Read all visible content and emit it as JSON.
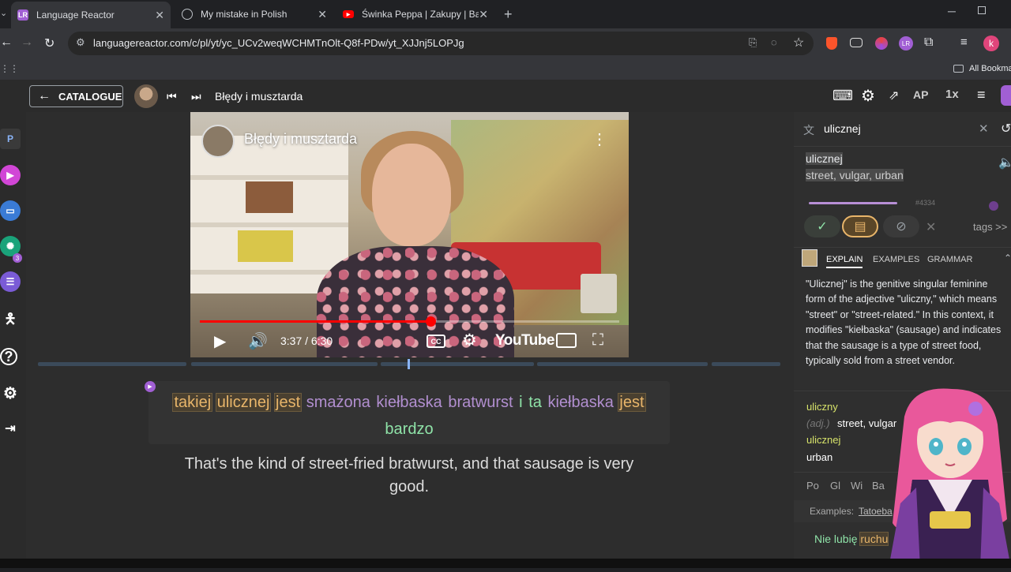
{
  "browser": {
    "tabs": [
      {
        "title": "Language Reactor",
        "favicon": "LR",
        "color": "#a15fd4"
      },
      {
        "title": "My mistake in Polish",
        "favicon": "globe",
        "color": "#9aa0a6"
      },
      {
        "title": "Świnka Peppa | Zakupy | Bajki P",
        "favicon": "youtube",
        "color": "#ff0000"
      }
    ],
    "url": "languagereactor.com/c/pl/yt/yc_UCv2weqWCHMTnOlt-Q8f-PDw/yt_XJJnj5LOPJg",
    "bookmarks_label": "All Bookmar",
    "profile_letter": "k"
  },
  "appbar": {
    "catalogue_label": "CATALOGUE",
    "video_title": "Błędy i musztarda",
    "speed": "1x",
    "ap_label": "AP"
  },
  "rail": {
    "p_label": "P",
    "badge_count": "3"
  },
  "video": {
    "title": "Błędy i musztarda",
    "time": "3:37 / 6:30",
    "progress": 0.55,
    "youtube_label": "YouTube"
  },
  "subtitle": {
    "words": [
      {
        "text": "takiej",
        "style": "hl"
      },
      {
        "text": "ulicznej",
        "style": "hl"
      },
      {
        "text": "jest",
        "style": "hl"
      },
      {
        "text": "smażona",
        "style": "purple"
      },
      {
        "text": "kiełbaska",
        "style": "purple"
      },
      {
        "text": "bratwurst",
        "style": "purple"
      },
      {
        "text": "i",
        "style": "green"
      },
      {
        "text": "ta",
        "style": "green"
      },
      {
        "text": "kiełbaska",
        "style": "purple"
      },
      {
        "text": "jest",
        "style": "hl"
      },
      {
        "text": "bardzo",
        "style": "green"
      }
    ],
    "translation": "That's the kind of street-fried bratwurst, and that sausage is very good."
  },
  "panel": {
    "search_value": "ulicznej",
    "word": "ulicznej",
    "meaning": "street, vulgar, urban",
    "rank": "#4334",
    "tabs": [
      "EXPLAIN",
      "EXAMPLES",
      "GRAMMAR"
    ],
    "tags_label": "tags >>",
    "explanation": "\"Ulicznej\" is the genitive singular feminine form of the adjective \"uliczny,\" which means \"street\" or \"street-related.\" In this context, it modifies \"kiełbaska\" (sausage) and indicates that the sausage is a type of street food, typically sold from a street vendor.",
    "dict": {
      "lemma": "uliczny",
      "pos": "(adj.)",
      "pos_gloss": "street, vulgar",
      "form": "ulicznej",
      "form_gloss": "urban"
    },
    "sources": [
      "Po",
      "Gl",
      "Wi",
      "Ba"
    ],
    "examples_prefix": "Examples:",
    "examples_link": "Tatoeba",
    "example_plain": "Nie lubię",
    "example_hl": "ruchu"
  },
  "colors": {
    "accent": "#a15fd4",
    "known": "#8fe3a8",
    "learning": "#e8b56a",
    "unknown": "#b28fd0"
  }
}
